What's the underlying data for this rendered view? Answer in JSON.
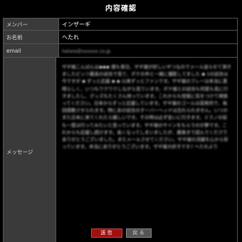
{
  "page": {
    "title": "内容確認"
  },
  "form": {
    "member_label": "メンバー",
    "member_value": "インザーギ",
    "name_label": "お名前",
    "name_value": "へたれ",
    "email_label": "email",
    "email_value": "hetare＠xxxxxx.co.jp",
    "message_label": "メッセージ",
    "message_value": "ザギ様こんばんは◆◆◆ 僕も昔日、ザギ様が好しいギつなのでメール送らせて頂きましたピッツ最高の試合で見て、ボテの弁と一緒に撮影してました ◆ 1の試合は今ですが ◆ ずっと応援 ◆ ◆ 以来ずっとファンです。ザギ様のプレーは本当に素晴らしく、いつもワクワクしながら見ています。ボテ様との試合も何度も見に行きましたし、グッズもたくさん持っています。これからも怪我に気をつけて頑張ってください。日本からずっと応援しています。ザギ様のゴールは芸術的で、毎回感動させられます。特にあの試合のオーバーヘッドは忘れられません。いつかまた日本に来てくれたら嬉しいです。その時は必ず会いに行きます。ミラノの街も一度は行ってみたいと思っています。ザギ様のサインをもらうのが夢です。これからも応援し続けます。長くなってしまいましたが、最後まで読んでくださりありがとうございました。またメールさせてください。ザギ様の活躍を心から祈っています。本当にありがとうございます。ザギ様大好きです♪ へたれより"
  },
  "buttons": {
    "send_label": "送 信",
    "back_label": "戻 る"
  },
  "colors": {
    "send_button": "#a01010",
    "back_button": "#555555",
    "label_bg": "#3a3a3a",
    "value_bg": "#000000"
  }
}
